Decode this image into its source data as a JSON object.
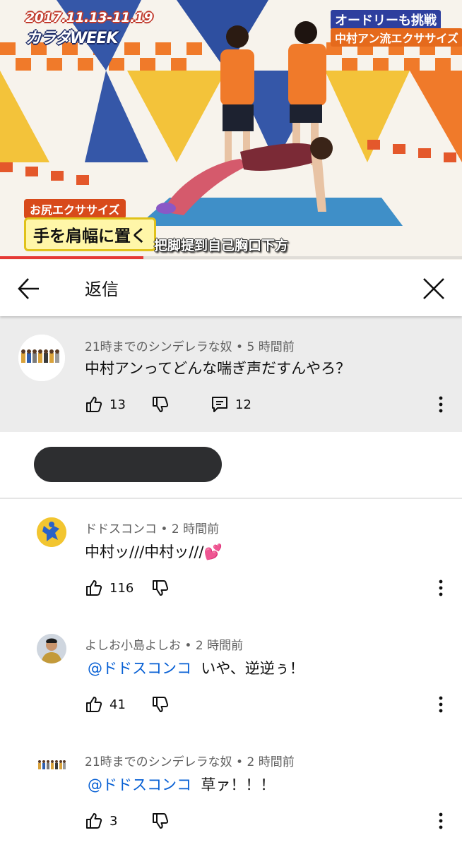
{
  "video": {
    "date_text": "2017.11.13-11.19",
    "week_text": "カラダWEEK",
    "top_right_line1": "オードリーも挑戦",
    "top_right_line2": "中村アン流エクササイズ",
    "caption_label": "お尻エクササイズ",
    "caption_main": "手を肩幅に置く",
    "subtitle": "把脚提到自己胸口下方",
    "progress": 0.31,
    "accent_color": "#e53935"
  },
  "header": {
    "title": "返信",
    "back_icon": "arrow-left-icon",
    "close_icon": "close-icon"
  },
  "parent_comment": {
    "author": "21時までのシンデレラな奴",
    "time": "5 時間前",
    "text": "中村アンってどんな喘ぎ声だすんやろ？",
    "likes": "13",
    "replies": "12"
  },
  "replies": [
    {
      "author": "ドドスコンコ",
      "time": "2 時間前",
      "mention": "",
      "text": "中村ッ///中村ッ///💕",
      "likes": "116"
    },
    {
      "author": "よしお小島よしお",
      "time": "2 時間前",
      "mention": "@ドドスコンコ",
      "text": "いや、逆逆ぅ！",
      "likes": "41"
    },
    {
      "author": "21時までのシンデレラな奴",
      "time": "2 時間前",
      "mention": "@ドドスコンコ",
      "text": "草ァ！！！",
      "likes": "3"
    }
  ]
}
